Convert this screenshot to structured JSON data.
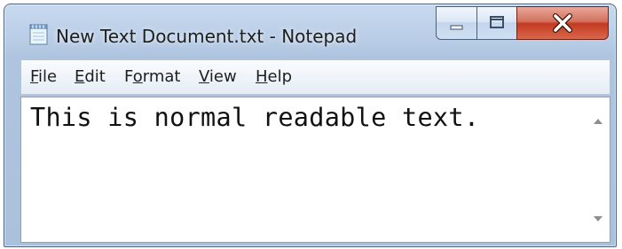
{
  "window": {
    "title": "New Text Document.txt - Notepad"
  },
  "menu": {
    "file": {
      "prefix": "",
      "accel": "F",
      "suffix": "ile"
    },
    "edit": {
      "prefix": "",
      "accel": "E",
      "suffix": "dit"
    },
    "format": {
      "prefix": "F",
      "accel": "o",
      "suffix": "rmat"
    },
    "view": {
      "prefix": "",
      "accel": "V",
      "suffix": "iew"
    },
    "help": {
      "prefix": "",
      "accel": "H",
      "suffix": "elp"
    }
  },
  "editor": {
    "content": "This is normal readable text."
  },
  "icons": {
    "app": "notepad-icon",
    "minimize": "minimize-icon",
    "maximize": "maximize-icon",
    "close": "close-icon",
    "scroll_up": "scroll-up-arrow-icon",
    "scroll_down": "scroll-down-arrow-icon"
  },
  "colors": {
    "close_button": "#c23a22",
    "titlebar": "#b9cde6"
  }
}
